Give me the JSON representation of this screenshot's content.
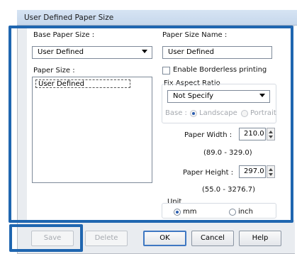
{
  "window": {
    "title": "User Defined Paper Size"
  },
  "base_paper_size": {
    "label": "Base Paper Size :",
    "value": "User Defined"
  },
  "paper_size_name": {
    "label": "Paper Size Name :",
    "value": "User Defined"
  },
  "paper_size": {
    "label": "Paper Size :",
    "items": [
      "User Defined"
    ]
  },
  "borderless": {
    "label": "Enable Borderless printing",
    "checked": false
  },
  "aspect": {
    "group_label": "Fix Aspect Ratio",
    "value": "Not Specify",
    "base_label": "Base :",
    "landscape_label": "Landscape",
    "portrait_label": "Portrait",
    "selected": "Landscape"
  },
  "width": {
    "label": "Paper Width :",
    "value": "210.0",
    "range": "(89.0 - 329.0)"
  },
  "height": {
    "label": "Paper Height :",
    "value": "297.0",
    "range": "(55.0 - 3276.7)"
  },
  "unit": {
    "group_label": "Unit",
    "mm_label": "mm",
    "inch_label": "inch",
    "selected": "mm"
  },
  "buttons": {
    "save": "Save",
    "delete": "Delete",
    "ok": "OK",
    "cancel": "Cancel",
    "help": "Help"
  },
  "colors": {
    "highlight": "#1f66b0",
    "titlebar": "#c6d7ec",
    "dialog_bg": "#e9ecf0"
  }
}
